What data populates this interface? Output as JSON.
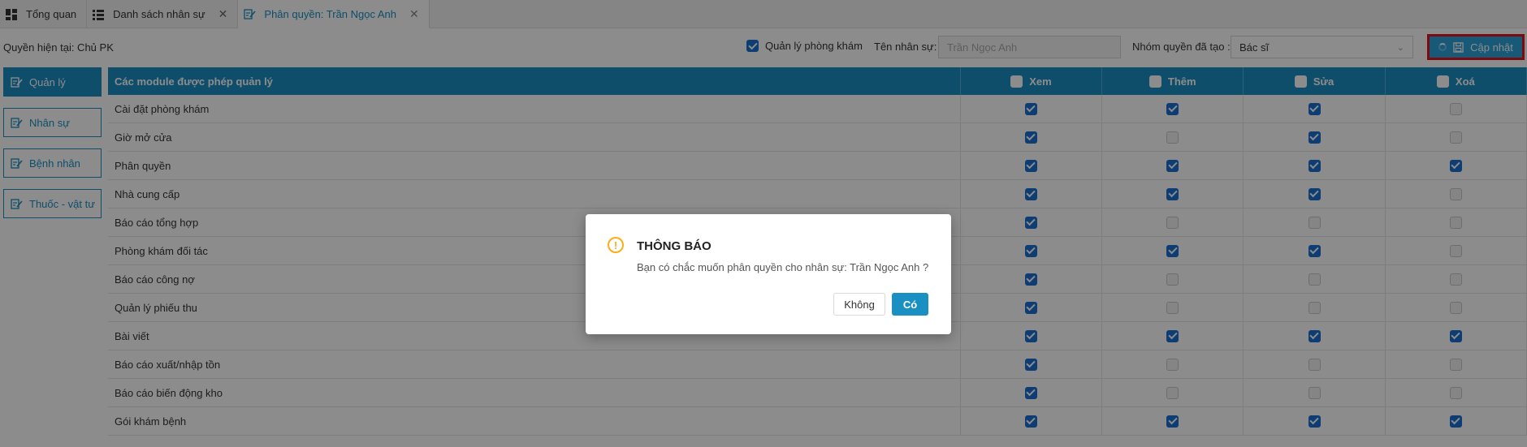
{
  "tabs": [
    {
      "label": "Tổng quan",
      "icon": "dashboard-icon",
      "closable": false,
      "active": false
    },
    {
      "label": "Danh sách nhân sự",
      "icon": "list-icon",
      "closable": true,
      "active": false
    },
    {
      "label": "Phân quyền: Trần Ngọc Anh",
      "icon": "edit-icon",
      "closable": true,
      "active": true
    }
  ],
  "tab_close_glyph": "✕",
  "toolbar": {
    "current_permission": "Quyền hiện tại: Chủ PK",
    "clinic_manage_label": "Quản lý phòng khám",
    "clinic_manage_checked": true,
    "staff_name_label": "Tên nhân sự:",
    "staff_name_value": "Trần Ngọc Anh",
    "group_label": "Nhóm quyền đã tạo :",
    "group_value": "Bác sĩ",
    "update_label": "Cập nhật"
  },
  "sidebar": [
    {
      "label": "Quản lý",
      "active": true
    },
    {
      "label": "Nhân sự",
      "active": false
    },
    {
      "label": "Bệnh nhân",
      "active": false
    },
    {
      "label": "Thuốc - vật tư",
      "active": false
    }
  ],
  "table": {
    "module_header": "Các module được phép quản lý",
    "perm_headers": [
      "Xem",
      "Thêm",
      "Sửa",
      "Xoá"
    ],
    "rows": [
      {
        "name": "Cài đặt phòng khám",
        "perms": [
          true,
          true,
          true,
          false
        ]
      },
      {
        "name": "Giờ mở cửa",
        "perms": [
          true,
          false,
          true,
          false
        ]
      },
      {
        "name": "Phân quyền",
        "perms": [
          true,
          true,
          true,
          true
        ]
      },
      {
        "name": "Nhà cung cấp",
        "perms": [
          true,
          true,
          true,
          false
        ]
      },
      {
        "name": "Báo cáo tổng hợp",
        "perms": [
          true,
          false,
          false,
          false
        ]
      },
      {
        "name": "Phòng khám đối tác",
        "perms": [
          true,
          true,
          true,
          false
        ]
      },
      {
        "name": "Báo cáo công nợ",
        "perms": [
          true,
          false,
          false,
          false
        ]
      },
      {
        "name": "Quản lý phiếu thu",
        "perms": [
          true,
          false,
          false,
          false
        ]
      },
      {
        "name": "Bài viết",
        "perms": [
          true,
          true,
          true,
          true
        ]
      },
      {
        "name": "Báo cáo xuất/nhập tồn",
        "perms": [
          true,
          false,
          false,
          false
        ]
      },
      {
        "name": "Báo cáo biến động kho",
        "perms": [
          true,
          false,
          false,
          false
        ]
      },
      {
        "name": "Gói khám bệnh",
        "perms": [
          true,
          true,
          true,
          true
        ]
      }
    ]
  },
  "dialog": {
    "icon": "exclamation-circle-icon",
    "icon_glyph": "!",
    "title": "THÔNG BÁO",
    "message": "Bạn có chắc muốn phân quyền cho nhân sự: Trần Ngọc Anh ?",
    "no_label": "Không",
    "yes_label": "Có"
  },
  "colors": {
    "primary": "#1a8fc2",
    "checkbox": "#1a6fd1",
    "warning": "#faad14",
    "highlight": "#e0141a"
  }
}
